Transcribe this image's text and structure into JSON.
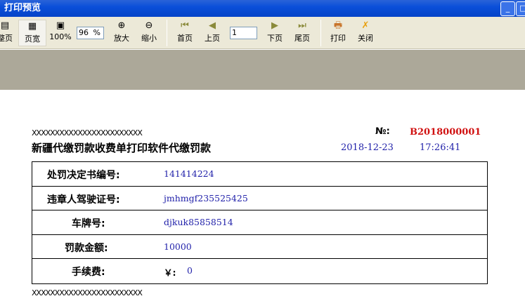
{
  "window": {
    "title": "打印预览"
  },
  "toolbar": {
    "whole_page": "整页",
    "page_width": "页宽",
    "actual": "100%",
    "zoom_value": "96",
    "zoom_unit": "%",
    "zoom_in": "放大",
    "zoom_out": "缩小",
    "first": "首页",
    "prev": "上页",
    "page_value": "1",
    "next": "下页",
    "last": "尾页",
    "print": "打印",
    "close": "关闭"
  },
  "receipt": {
    "header_mask": "XXXXXXXXXXXXXXXXXXXXXXXX",
    "title": "新疆代缴罚款收费单打印软件代缴罚款",
    "no_label": "№:",
    "no_value": "B2018000001",
    "date": "2018-12-23",
    "time": "17:26:41",
    "rows": [
      {
        "label": "处罚决定书编号:",
        "value": "141414224"
      },
      {
        "label": "违章人驾驶证号:",
        "value": "jmhmgf235525425"
      },
      {
        "label": "车牌号:",
        "value": "djkuk85858514"
      },
      {
        "label": "罚款金额:",
        "value": "10000"
      },
      {
        "label": "手续费:",
        "currency": "￥:",
        "value": "0"
      }
    ],
    "footer_mask": "XXXXXXXXXXXXXXXXXXXXXXXX"
  },
  "colors": {
    "accent_red": "#d01010",
    "value_blue": "#2222aa"
  }
}
